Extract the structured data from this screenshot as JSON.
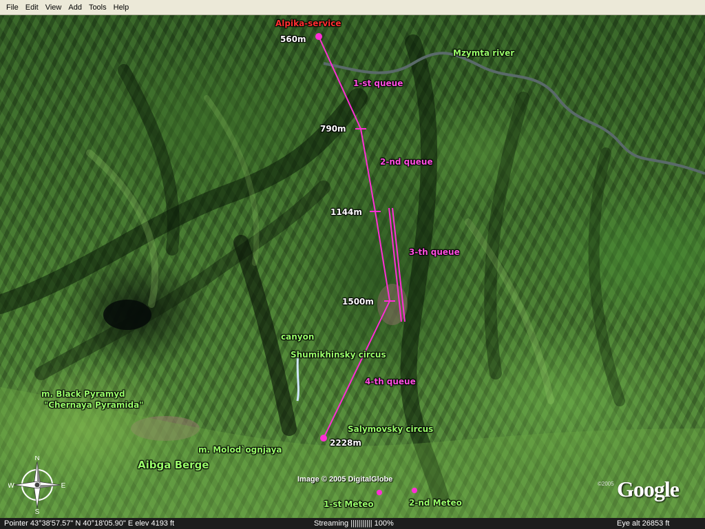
{
  "menu": {
    "items": [
      "File",
      "Edit",
      "View",
      "Add",
      "Tools",
      "Help"
    ]
  },
  "map": {
    "labels": {
      "alpika_service": "Alpika-service",
      "alt_560": "560m",
      "mzymta_river": "Mzymta river",
      "queue_1": "1-st queue",
      "alt_790": "790m",
      "queue_2": "2-nd queue",
      "alt_1144": "1144m",
      "queue_3": "3-th queue",
      "alt_1500": "1500m",
      "canyon": "canyon",
      "shumikhinsky": "Shumikhinsky circus",
      "queue_4": "4-th queue",
      "black_pyramid": "m. Black Pyramyd",
      "chernaya_pyramida": "\"Chernaya Pyramida\"",
      "salymovsky": "Salymovsky circus",
      "alt_2228": "2228m",
      "molodognaya": "m. Molod`ognjaya",
      "aibga_berge": "Aibga Berge",
      "meteo_1": "1-st Meteo",
      "meteo_2": "2-nd Meteo"
    },
    "colors": {
      "route": "#ff2fd5",
      "label_magenta": "#ff4fe0",
      "label_green": "#9aff6a",
      "label_red": "#ff3030",
      "river": "#5a6a6a"
    },
    "copyright": "Image © 2005 DigitalGlobe",
    "google_year": "©2005",
    "google_logo": "Google",
    "compass": {
      "icon": "compass-rose-icon",
      "n": "N",
      "s": "S",
      "e": "E",
      "w": "W"
    }
  },
  "status": {
    "pointer": "Pointer  43°38'57.57\" N   40°18'05.90\" E   elev  4193 ft",
    "streaming": "Streaming ||||||||||| 100%",
    "eye_alt": "Eye  alt    26853 ft"
  }
}
